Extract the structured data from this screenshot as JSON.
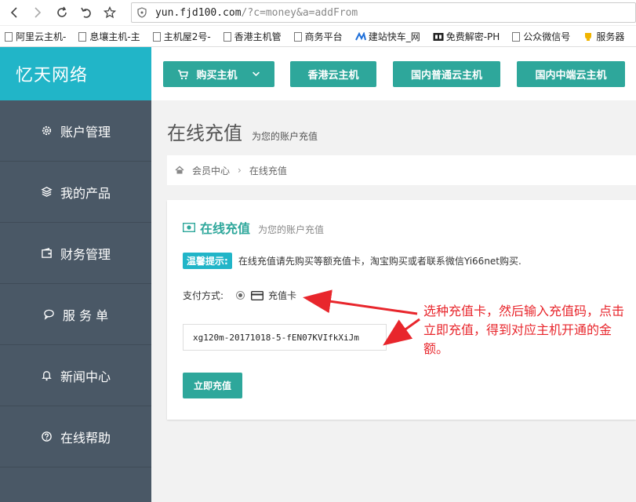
{
  "browser": {
    "url_host": "yun.fjd100.com",
    "url_path": "/?c=money&a=addFrom",
    "bookmarks": [
      "阿里云主机-",
      "息壤主机-主",
      "主机屋2号-",
      "香港主机管",
      "商务平台",
      "建站快车_网",
      "免费解密-PH",
      "公众微信号",
      "服务器"
    ]
  },
  "sidebar": {
    "brand": "忆天网络",
    "items": [
      {
        "label": "账户管理",
        "icon": "gear-icon"
      },
      {
        "label": "我的产品",
        "icon": "layers-icon"
      },
      {
        "label": "财务管理",
        "icon": "wallet-icon"
      },
      {
        "label": "服 务 单",
        "icon": "chat-icon"
      },
      {
        "label": "新闻中心",
        "icon": "bell-icon"
      },
      {
        "label": "在线帮助",
        "icon": "help-icon"
      }
    ]
  },
  "topnav": {
    "buy": "购买主机",
    "hk": "香港云主机",
    "normal": "国内普通云主机",
    "mid": "国内中端云主机"
  },
  "page": {
    "title": "在线充值",
    "subtitle": "为您的账户充值",
    "breadcrumb_home": "会员中心",
    "breadcrumb_current": "在线充值"
  },
  "card": {
    "title": "在线充值",
    "subtitle": "为您的账户充值",
    "tip_badge": "温馨提示:",
    "tip_text": "在线充值请先购买等额充值卡，淘宝购买或者联系微信Yi66net购买.",
    "pay_label": "支付方式:",
    "pay_option": "充值卡",
    "code_value": "xg120m-20171018-5-fEN07KVIfkXiJm",
    "submit": "立即充值"
  },
  "annotation": {
    "text": "选种充值卡，然后输入充值码，点击立即充值，得到对应主机开通的金额。",
    "color": "#e8262c"
  },
  "colors": {
    "brand": "#21b5c8",
    "button": "#2ea79b",
    "sidebar": "#4a5866"
  }
}
